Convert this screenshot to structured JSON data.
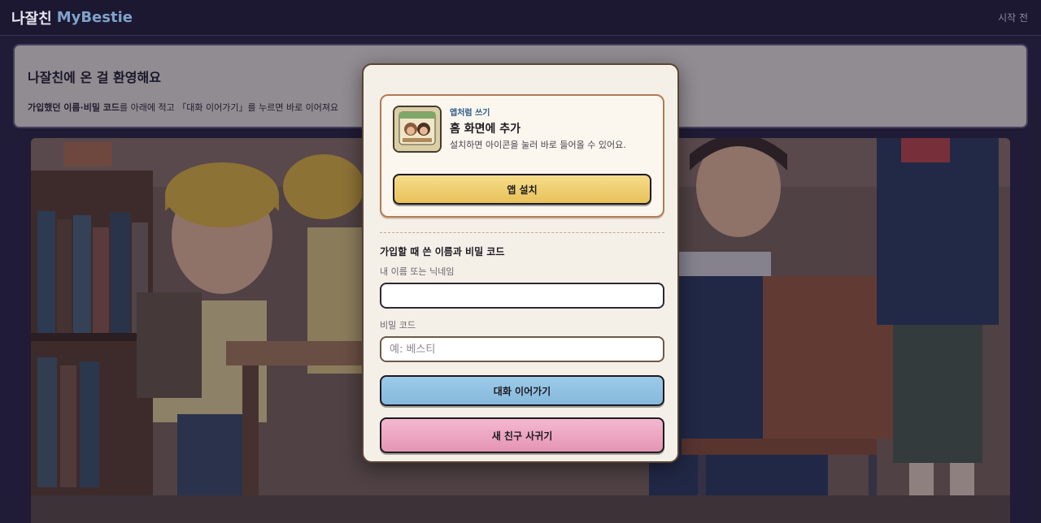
{
  "header": {
    "brand_kr": "나잘친",
    "brand_en": "MyBestie",
    "status": "시작 전"
  },
  "welcome": {
    "title": "나잘친에 온 걸 환영해요",
    "text_bold": "가입했던 이름·비밀 코드",
    "text_rest": "를 아래에 적고 「대화 이어가기」를 누르면 바로 이어져요"
  },
  "install": {
    "kicker": "앱처럼 쓰기",
    "title": "홈 화면에 추가",
    "description": "설치하면 아이콘을 눌러 바로 들어올 수 있어요.",
    "button": "앱 설치"
  },
  "form": {
    "heading": "가입할 때 쓴 이름과 비밀 코드",
    "name_label": "내 이름 또는 닉네임",
    "name_value": "",
    "code_label": "비밀 코드",
    "code_placeholder": "예: 베스티",
    "continue_button": "대화 이어가기",
    "new_button": "새 친구 사귀기"
  }
}
